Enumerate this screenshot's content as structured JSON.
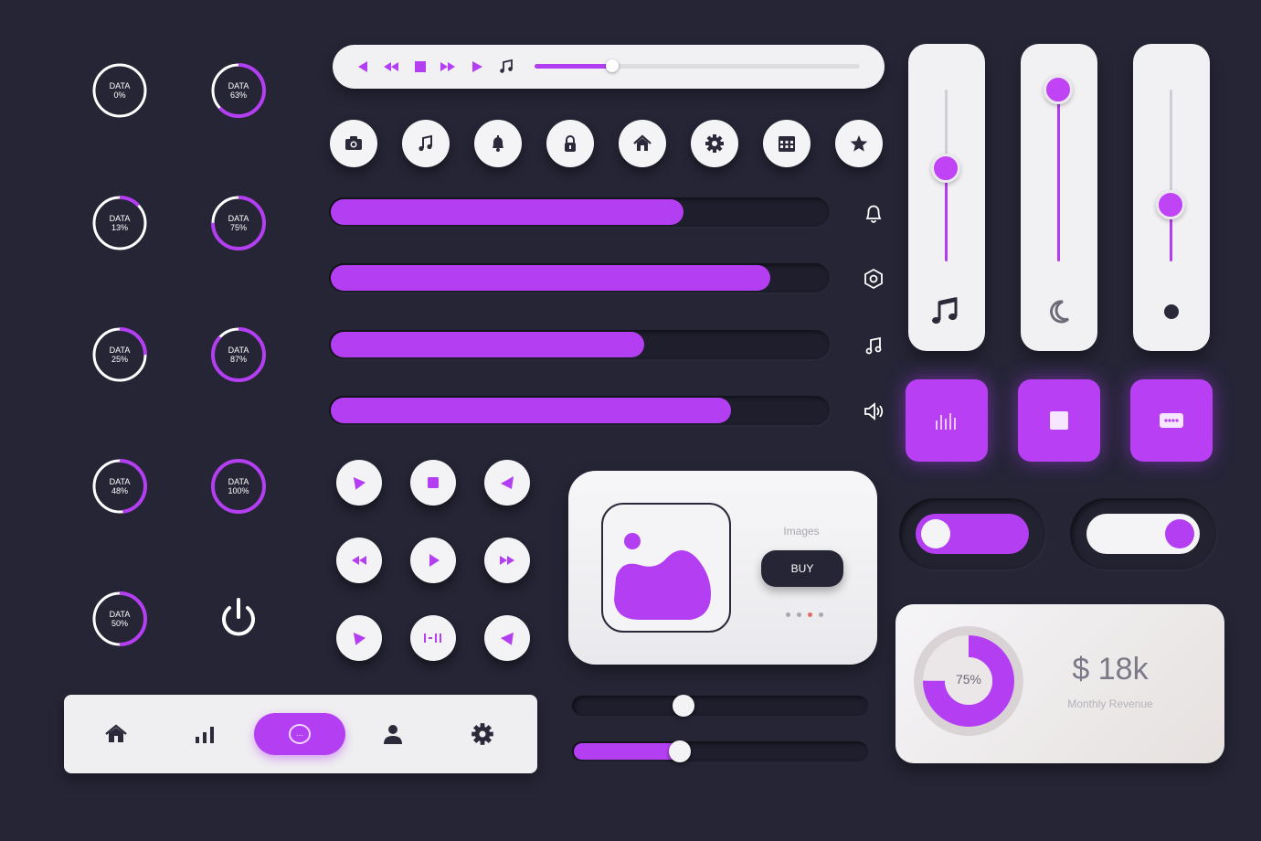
{
  "colors": {
    "background": "#252536",
    "accent": "#b43ff2",
    "card": "#f1f0f3",
    "dark_icon": "#2b2a3a"
  },
  "gauges": [
    {
      "label": "DATA",
      "value_text": "0%",
      "value": 0
    },
    {
      "label": "DATA",
      "value_text": "63%",
      "value": 63
    },
    {
      "label": "DATA",
      "value_text": "13%",
      "value": 13
    },
    {
      "label": "DATA",
      "value_text": "75%",
      "value": 75
    },
    {
      "label": "DATA",
      "value_text": "25%",
      "value": 25
    },
    {
      "label": "DATA",
      "value_text": "87%",
      "value": 87
    },
    {
      "label": "DATA",
      "value_text": "48%",
      "value": 48
    },
    {
      "label": "DATA",
      "value_text": "100%",
      "value": 100
    },
    {
      "label": "DATA",
      "value_text": "50%",
      "value": 50
    }
  ],
  "power_button": {
    "icon": "power-icon"
  },
  "media_bar": {
    "controls": [
      "previous-icon",
      "rewind-icon",
      "stop-icon",
      "fast-forward-icon",
      "play-icon",
      "music-note-icon"
    ],
    "progress": 0.24
  },
  "icon_buttons": [
    "camera-icon",
    "music-note-icon",
    "bell-icon",
    "lock-icon",
    "home-icon",
    "gear-icon",
    "calendar-icon",
    "star-icon"
  ],
  "progress_bars": [
    {
      "value": 0.71,
      "icon": "bell-icon"
    },
    {
      "value": 0.885,
      "icon": "hexagon-settings-icon"
    },
    {
      "value": 0.63,
      "icon": "music-note-icon"
    },
    {
      "value": 0.805,
      "icon": "volume-icon"
    }
  ],
  "vertical_sliders": [
    {
      "value": 0.54,
      "icon": "music-note-icon"
    },
    {
      "value": 1.0,
      "icon": "moon-icon"
    },
    {
      "value": 0.33,
      "icon": "dot-icon"
    }
  ],
  "square_buttons": [
    "equalizer-icon",
    "stop-icon",
    "chat-icon"
  ],
  "toggles": [
    {
      "on": false
    },
    {
      "on": true
    }
  ],
  "revenue": {
    "percent_text": "75%",
    "percent": 75,
    "amount": "$ 18k",
    "label": "Monthly Revenue"
  },
  "media_buttons": [
    "play-icon",
    "stop-icon",
    "back-icon",
    "rewind-icon",
    "play-icon",
    "fast-forward-icon",
    "play-icon",
    "play-pause-icon",
    "back-icon"
  ],
  "image_card": {
    "title": "Images",
    "button_label": "BUY",
    "pager_dots": 4,
    "active_dot": 3
  },
  "h_sliders": [
    {
      "value": 0.375,
      "filled": false
    },
    {
      "value": 0.365,
      "filled": true
    }
  ],
  "navbar": {
    "items": [
      "home-icon",
      "bar-chart-icon",
      "chat-icon",
      "user-icon",
      "gear-icon"
    ],
    "active": 2,
    "active_label": "..."
  }
}
